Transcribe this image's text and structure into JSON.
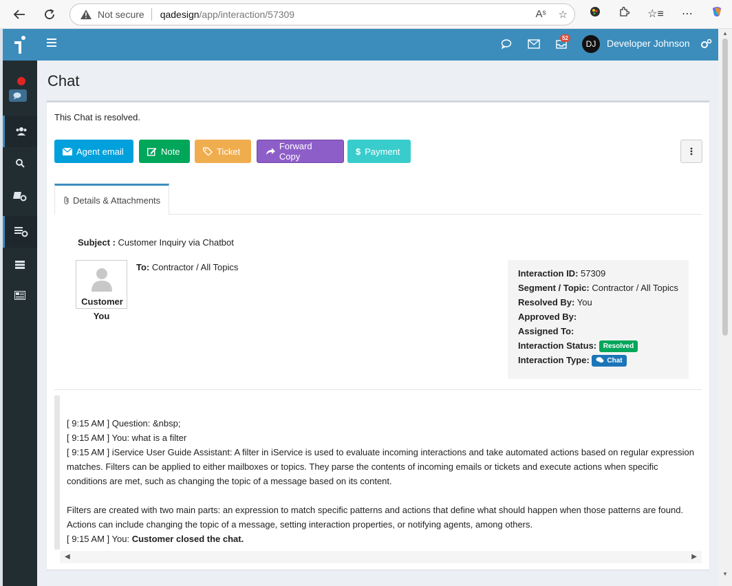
{
  "browser": {
    "security_label": "Not secure",
    "url_host": "qadesign",
    "url_path": "/app/interaction/57309"
  },
  "header": {
    "mail_badge": "52",
    "user_initials": "DJ",
    "user_name": "Developer Johnson"
  },
  "page": {
    "title": "Chat",
    "status_note": "This Chat is resolved."
  },
  "actions": {
    "agent_email": "Agent email",
    "note": "Note",
    "ticket": "Ticket",
    "forward_copy": "Forward Copy",
    "payment": "Payment"
  },
  "tabs": {
    "details": "Details & Attachments"
  },
  "details": {
    "subject_label": "Subject :",
    "subject_value": "Customer Inquiry via Chatbot",
    "to_label": "To:",
    "to_value": "Contractor / All Topics",
    "contact_name": "Customer",
    "contact_sub": "You"
  },
  "info": {
    "id_label": "Interaction ID:",
    "id_value": "57309",
    "segment_label": "Segment / Topic:",
    "segment_value": "Contractor / All Topics",
    "resolved_label": "Resolved By:",
    "resolved_value": "You",
    "approved_label": "Approved By:",
    "approved_value": "",
    "assigned_label": "Assigned To:",
    "assigned_value": "",
    "status_label": "Interaction Status:",
    "status_value": "Resolved",
    "type_label": "Interaction Type:",
    "type_value": "Chat"
  },
  "transcript": {
    "line1": "[ 9:15 AM ] Question: &nbsp;",
    "line2": "[ 9:15 AM ] You: what is a filter",
    "line3": "[ 9:15 AM ] iService User Guide Assistant: A filter in iService is used to evaluate incoming interactions and take automated actions based on regular expression matches. Filters can be applied to either mailboxes or topics. They parse the contents of incoming emails or tickets and execute actions when specific conditions are met, such as changing the topic of a message based on its content.",
    "line4": "Filters are created with two main parts: an expression to match specific patterns and actions that define what should happen when those patterns are found. Actions can include changing the topic of a message, setting interaction properties, or notifying agents, among others.",
    "line5_prefix": "[ 9:15 AM ] You: ",
    "line5_bold": "Customer closed the chat."
  },
  "colors": {
    "primary": "#3c8dbc",
    "sidebar": "#222d32",
    "agent_email": "#00a0dc",
    "note": "#00a65a",
    "ticket": "#f0ad4e",
    "forward_copy": "#8e5ec8",
    "payment": "#39cccc"
  },
  "icons": {
    "back": "back-arrow-icon",
    "reload": "reload-icon",
    "warning": "warning-icon",
    "read_aloud": "read-aloud-icon",
    "favorite": "star-icon",
    "menu": "hamburger-icon",
    "chat": "chat-bubble-icon",
    "mail": "envelope-icon",
    "inbox": "inbox-icon",
    "settings": "gears-icon"
  }
}
